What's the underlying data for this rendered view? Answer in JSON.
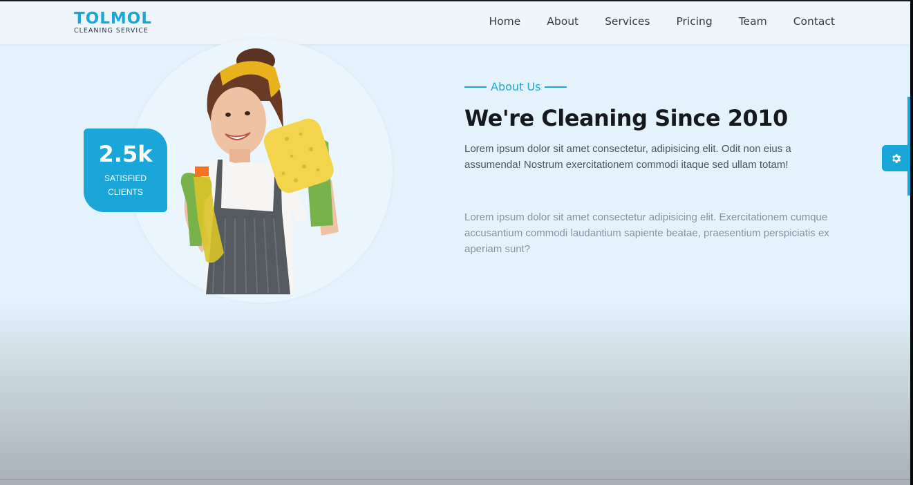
{
  "brand": {
    "name": "TOLMOL",
    "tagline": "CLEANING SERVICE",
    "accent_color": "#1aa6d9"
  },
  "nav": {
    "items": [
      {
        "label": "Home"
      },
      {
        "label": "About"
      },
      {
        "label": "Services"
      },
      {
        "label": "Pricing"
      },
      {
        "label": "Team"
      },
      {
        "label": "Contact"
      }
    ]
  },
  "hero_image": {
    "subject": "smiling woman in yellow headband and apron holding spray bottle and sponge"
  },
  "stat": {
    "value": "2.5k",
    "label": "SATISFIED CLIENTS"
  },
  "about": {
    "eyebrow": "About Us",
    "title": "We're Cleaning Since 2010",
    "paragraph1": "Lorem ipsum dolor sit amet consectetur, adipisicing elit. Odit non eius a assumenda! Nostrum exercitationem commodi itaque sed ullam totam!",
    "paragraph2": "Lorem ipsum dolor sit amet consectetur adipisicing elit. Exercitationem cumque accusantium commodi laudantium sapiente beatae, praesentium perspiciatis ex aperiam sunt?"
  },
  "settings": {
    "icon": "gear-icon"
  }
}
